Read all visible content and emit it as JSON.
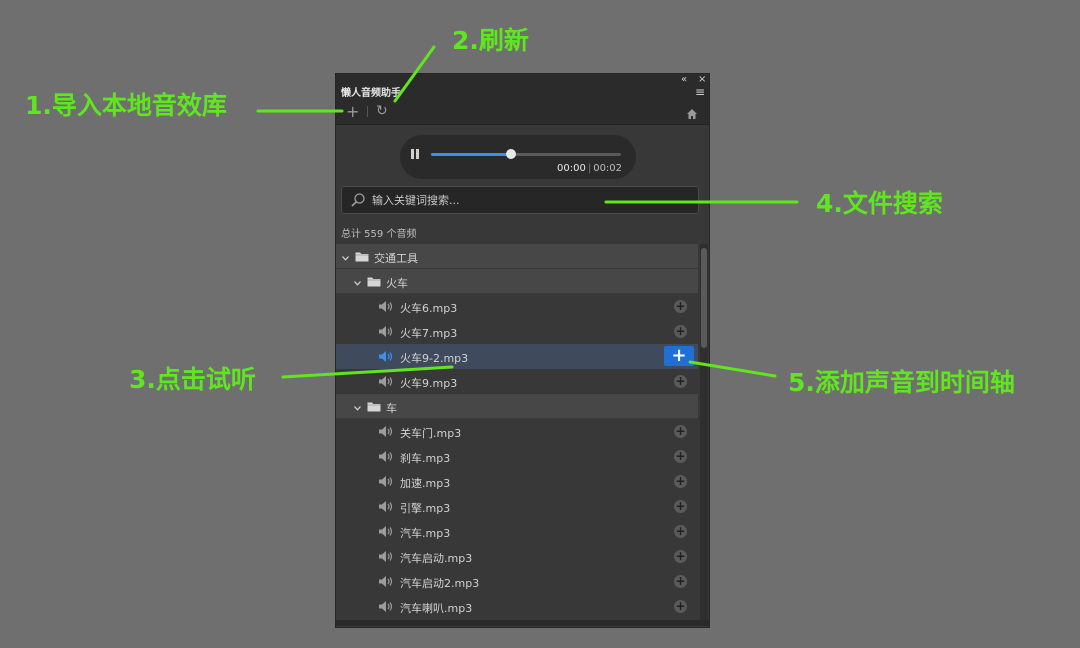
{
  "callouts": {
    "import_local": "1.导入本地音效库",
    "refresh": "2.刷新",
    "click_preview": "3.点击试听",
    "file_search": "4.文件搜索",
    "add_to_timeline": "5.添加声音到时间轴"
  },
  "panel": {
    "title": "懒人音频助手",
    "collapse_icon": "«",
    "close_icon": "×",
    "menu_icon": "≡"
  },
  "toolbar": {
    "add_icon": "+",
    "refresh_icon": "↻",
    "home_icon": "home-icon"
  },
  "player": {
    "current_time": "00:00",
    "separator": "|",
    "duration": "00:02",
    "progress": 0.42
  },
  "search": {
    "placeholder": "输入关键词搜索..."
  },
  "summary": {
    "total": "总计 559 个音频"
  },
  "tree": [
    {
      "type": "folder",
      "level": 0,
      "label": "交通工具"
    },
    {
      "type": "folder",
      "level": 1,
      "label": "火车"
    },
    {
      "type": "file",
      "label": "火车6.mp3",
      "selected": false
    },
    {
      "type": "file",
      "label": "火车7.mp3",
      "selected": false
    },
    {
      "type": "file",
      "label": "火车9-2.mp3",
      "selected": true
    },
    {
      "type": "file",
      "label": "火车9.mp3",
      "selected": false
    },
    {
      "type": "folder",
      "level": 1,
      "label": "车"
    },
    {
      "type": "file",
      "label": "关车门.mp3",
      "selected": false
    },
    {
      "type": "file",
      "label": "刹车.mp3",
      "selected": false
    },
    {
      "type": "file",
      "label": "加速.mp3",
      "selected": false
    },
    {
      "type": "file",
      "label": "引擎.mp3",
      "selected": false
    },
    {
      "type": "file",
      "label": "汽车.mp3",
      "selected": false
    },
    {
      "type": "file",
      "label": "汽车启动.mp3",
      "selected": false
    },
    {
      "type": "file",
      "label": "汽车启动2.mp3",
      "selected": false
    },
    {
      "type": "file",
      "label": "汽车喇叭.mp3",
      "selected": false
    }
  ],
  "colors": {
    "callout": "#5fe61e",
    "accent": "#1f6fd6",
    "progress": "#3b8ff0",
    "speaker_active": "#3b8ff0"
  }
}
